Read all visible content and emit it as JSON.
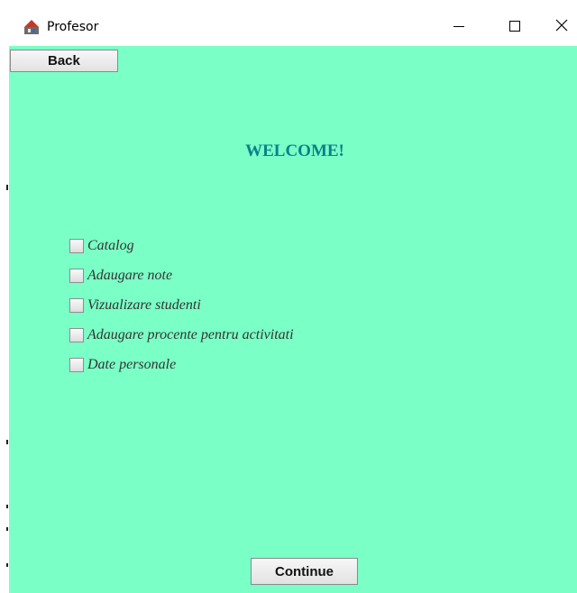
{
  "window": {
    "title": "Profesor",
    "icon": "java-app-icon",
    "controls": [
      "minimize-icon",
      "maximize-icon",
      "close-icon"
    ]
  },
  "content": {
    "background": "#7affc6",
    "back_label": "Back",
    "welcome": "WELCOME!",
    "welcome_color": "#0c7f8c",
    "options": [
      {
        "label": "Catalog",
        "checked": false
      },
      {
        "label": "Adaugare note",
        "checked": false
      },
      {
        "label": "Vizualizare studenti",
        "checked": false
      },
      {
        "label": "Adaugare procente pentru activitati",
        "checked": false
      },
      {
        "label": "Date personale",
        "checked": false
      }
    ],
    "continue_label": "Continue"
  }
}
